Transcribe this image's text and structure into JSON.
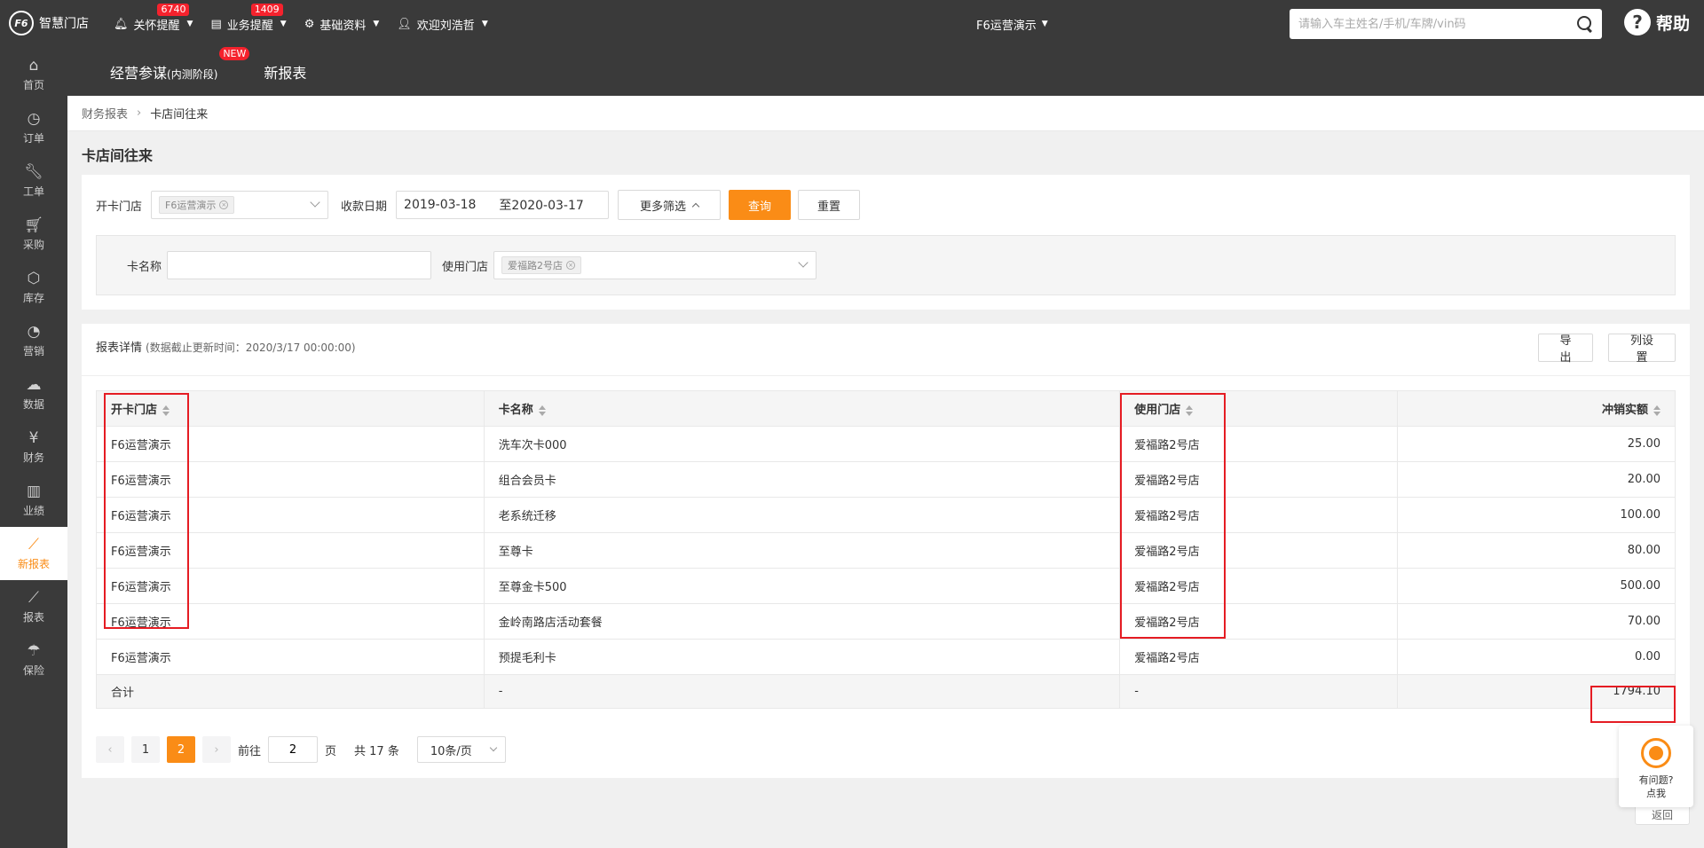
{
  "app": {
    "logo_mark": "F6",
    "logo_text": "智慧门店"
  },
  "topnav": [
    {
      "label": "关怀提醒",
      "badge": "6740"
    },
    {
      "label": "业务提醒",
      "badge": "1409"
    },
    {
      "label": "基础资料",
      "badge": ""
    },
    {
      "label": "欢迎刘浩哲",
      "badge": ""
    }
  ],
  "store": "F6运营演示",
  "search": {
    "placeholder": "请输入车主姓名/手机/车牌/vin码"
  },
  "help": "帮助",
  "sidebar": [
    {
      "label": "首页",
      "icon": "home-icon"
    },
    {
      "label": "订单",
      "icon": "clock-icon"
    },
    {
      "label": "工单",
      "icon": "wrench-icon"
    },
    {
      "label": "采购",
      "icon": "cart-icon"
    },
    {
      "label": "库存",
      "icon": "box-icon"
    },
    {
      "label": "营销",
      "icon": "pie-icon"
    },
    {
      "label": "数据",
      "icon": "cloud-icon"
    },
    {
      "label": "财务",
      "icon": "yen-icon"
    },
    {
      "label": "业绩",
      "icon": "bar-icon"
    },
    {
      "label": "新报表",
      "icon": "line-chart-icon",
      "active": true
    },
    {
      "label": "报表",
      "icon": "line-chart-icon"
    },
    {
      "label": "保险",
      "icon": "umbrella-icon"
    }
  ],
  "subhead": {
    "tab1": "经营参谋",
    "tab1_small": "(内测阶段)",
    "tab1_badge": "NEW",
    "tab2": "新报表"
  },
  "breadcrumb": {
    "parent": "财务报表",
    "current": "卡店间往来"
  },
  "page_title": "卡店间往来",
  "filters": {
    "open_store_label": "开卡门店",
    "open_store_tag": "F6运营演示",
    "date_label": "收款日期",
    "date_start": "2019-03-18",
    "date_end": "至2020-03-17",
    "more_filter": "更多筛选",
    "query": "查询",
    "reset": "重置",
    "card_name_label": "卡名称",
    "card_name_value": "",
    "use_store_label": "使用门店",
    "use_store_tag": "爱福路2号店"
  },
  "report": {
    "title": "报表详情",
    "subtitle": "(数据截止更新时间：2020/3/17 00:00:00)",
    "export": "导出",
    "column_settings": "列设置",
    "columns": [
      "开卡门店",
      "卡名称",
      "使用门店",
      "冲销实额"
    ],
    "rows": [
      [
        "F6运营演示",
        "洗车次卡000",
        "爱福路2号店",
        "25.00"
      ],
      [
        "F6运营演示",
        "组合会员卡",
        "爱福路2号店",
        "20.00"
      ],
      [
        "F6运营演示",
        "老系统迁移",
        "爱福路2号店",
        "100.00"
      ],
      [
        "F6运营演示",
        "至尊卡",
        "爱福路2号店",
        "80.00"
      ],
      [
        "F6运营演示",
        "至尊金卡500",
        "爱福路2号店",
        "500.00"
      ],
      [
        "F6运营演示",
        "金岭南路店活动套餐",
        "爱福路2号店",
        "70.00"
      ],
      [
        "F6运营演示",
        "预提毛利卡",
        "爱福路2号店",
        "0.00"
      ]
    ],
    "total": [
      "合计",
      "-",
      "-",
      "1794.10"
    ]
  },
  "pagination": {
    "pages": [
      "1",
      "2"
    ],
    "current": "2",
    "goto_prefix": "前往",
    "goto_value": "2",
    "goto_suffix": "页",
    "total_text": "共 17 条",
    "page_size": "10条/页"
  },
  "float_help": {
    "line1": "有问题?",
    "line2": "点我"
  },
  "back": "返回",
  "colors": {
    "accent": "#fa8c16",
    "topbar": "#3a3a3a",
    "highlight": "#e51c23"
  }
}
